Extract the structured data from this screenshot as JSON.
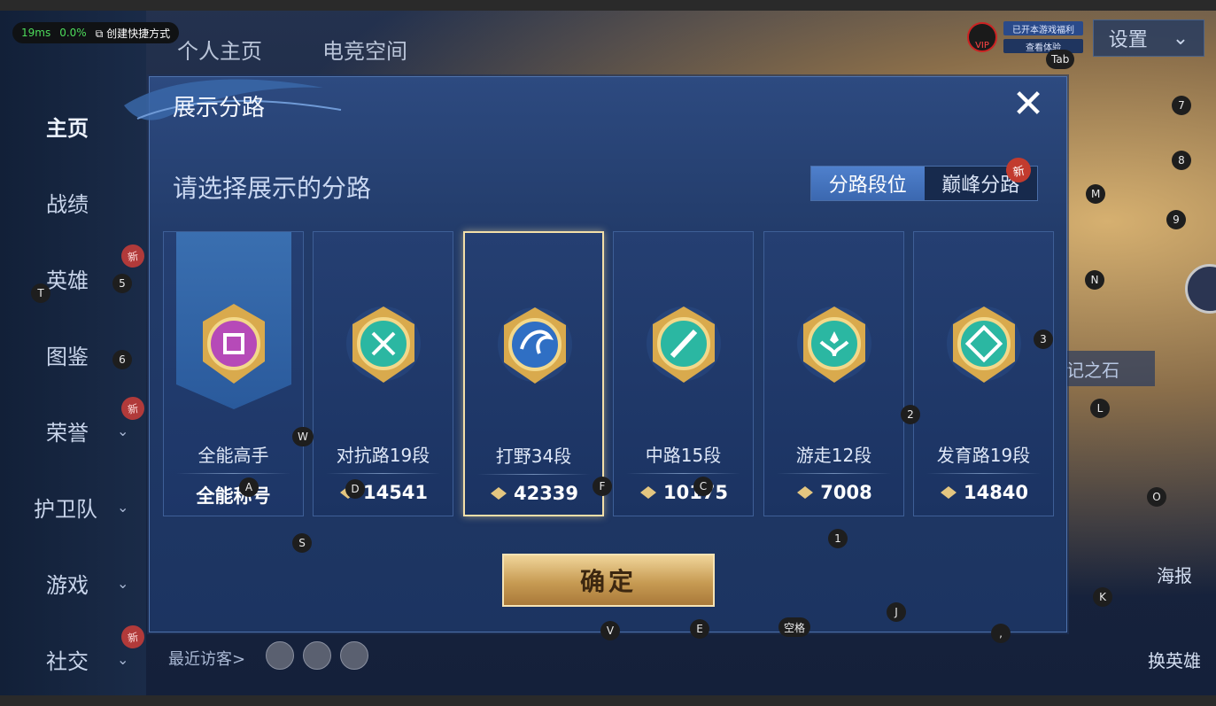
{
  "perf": {
    "latency": "19ms",
    "loss": "0.0%",
    "shortcut": "创建快捷方式"
  },
  "header": {
    "tab1": "个人主页",
    "tab2": "电竞空间"
  },
  "settings": {
    "label": "设置",
    "chevron": "⌄"
  },
  "vip": {
    "label": "VIP",
    "chip1": "已开本游戏福利",
    "chip2": "查看体验"
  },
  "nav": {
    "items": [
      {
        "label": "主页"
      },
      {
        "label": "战绩"
      },
      {
        "label": "英雄"
      },
      {
        "label": "图鉴"
      },
      {
        "label": "荣誉"
      },
      {
        "label": "护卫队"
      },
      {
        "label": "游戏"
      },
      {
        "label": "社交"
      }
    ],
    "new_tag": "新"
  },
  "visitors": {
    "label": "最近访客>"
  },
  "right": {
    "rune": "记之石",
    "poster": "海报",
    "swap": "换英雄"
  },
  "modal": {
    "title": "展示分路",
    "close": "✕",
    "subtitle": "请选择展示的分路",
    "toggle": {
      "option1": "分路段位",
      "option2": "巅峰分路",
      "new_tag": "新"
    },
    "cards": [
      {
        "name": "全能高手",
        "score": "全能称号",
        "color": "#b64ab8"
      },
      {
        "name": "对抗路19段",
        "score": "14541",
        "color": "#2bb7a2"
      },
      {
        "name": "打野34段",
        "score": "42339",
        "color": "#2f6fc4"
      },
      {
        "name": "中路15段",
        "score": "10175",
        "color": "#2bb7a2"
      },
      {
        "name": "游走12段",
        "score": "7008",
        "color": "#2bb7a2"
      },
      {
        "name": "发育路19段",
        "score": "14840",
        "color": "#2bb7a2"
      }
    ],
    "confirm": "确定"
  },
  "keys": [
    "Tab",
    "7",
    "8",
    "M",
    "9",
    "N",
    "3",
    "T",
    "5",
    "6",
    "2",
    "L",
    "W",
    "D",
    "F",
    "C",
    "A",
    "O",
    "S",
    "1",
    "K",
    "V",
    "E",
    "空格",
    "J",
    ","
  ]
}
